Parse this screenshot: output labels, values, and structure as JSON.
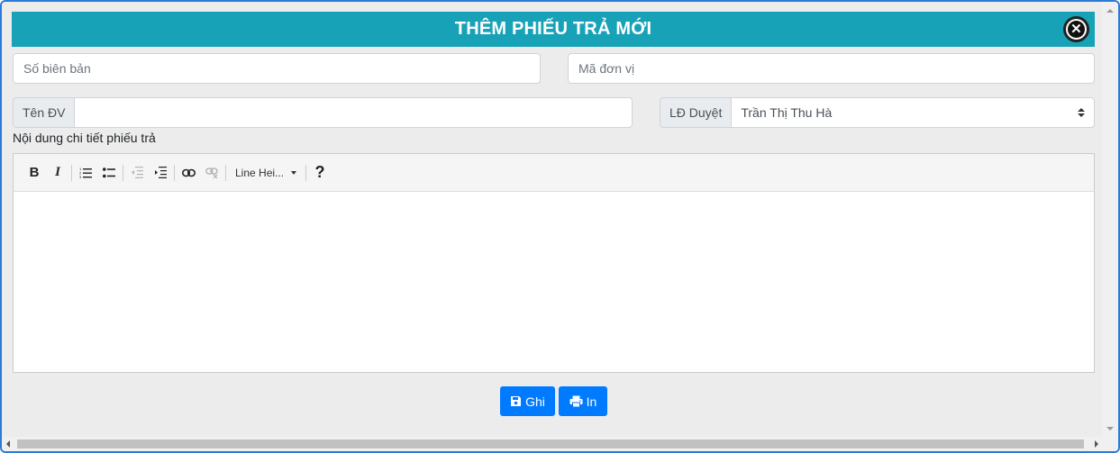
{
  "modal": {
    "title": "THÊM PHIẾU TRẢ MỚI",
    "close_icon": "close-circle-icon"
  },
  "form": {
    "so_bien_ban": {
      "placeholder": "Số biên bản",
      "value": ""
    },
    "ma_don_vi": {
      "placeholder": "Mã đơn vị",
      "value": ""
    },
    "ten_dv": {
      "label": "Tên ĐV",
      "value": ""
    },
    "ld_duyet": {
      "label": "LĐ Duyệt",
      "selected": "Trần Thị Thu Hà"
    },
    "content_label": "Nội dung chi tiết phiếu trả"
  },
  "editor": {
    "toolbar": {
      "line_height_label": "Line Hei...",
      "help_label": "?"
    }
  },
  "actions": {
    "save_label": "Ghi",
    "print_label": "In"
  },
  "colors": {
    "header": "#17a2b8",
    "primary": "#007bff",
    "background": "#ececec"
  }
}
